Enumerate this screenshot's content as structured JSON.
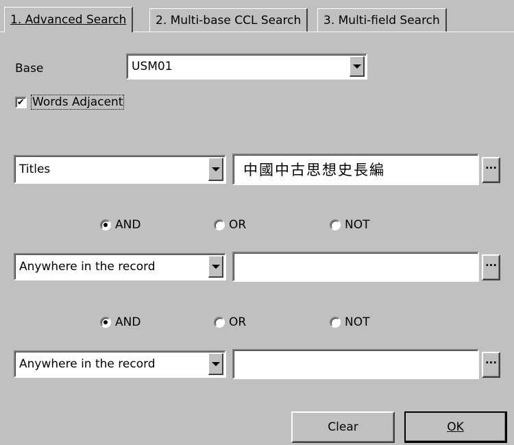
{
  "tabs": [
    {
      "label": "1. Advanced Search",
      "active": true
    },
    {
      "label": "2. Multi-base CCL Search",
      "active": false
    },
    {
      "label": "3. Multi-field Search",
      "active": false
    }
  ],
  "base": {
    "label": "Base",
    "value": "USM01"
  },
  "words_adjacent": {
    "label": "Words Adjacent",
    "checked": true,
    "check_glyph": "✔"
  },
  "rows": [
    {
      "field": "Titles",
      "term": "中國中古思想史長編",
      "more_label": "···"
    },
    {
      "field": "Anywhere in the record",
      "term": "",
      "more_label": "···"
    },
    {
      "field": "Anywhere in the record",
      "term": "",
      "more_label": "···"
    }
  ],
  "operators": [
    {
      "options": [
        "AND",
        "OR",
        "NOT"
      ],
      "selected": "AND"
    },
    {
      "options": [
        "AND",
        "OR",
        "NOT"
      ],
      "selected": "AND"
    }
  ],
  "buttons": {
    "clear": "Clear",
    "ok": "OK"
  },
  "colors": {
    "face": "#c0c0c0",
    "field": "#ffffff",
    "shadow": "#808080",
    "dark": "#404040"
  }
}
